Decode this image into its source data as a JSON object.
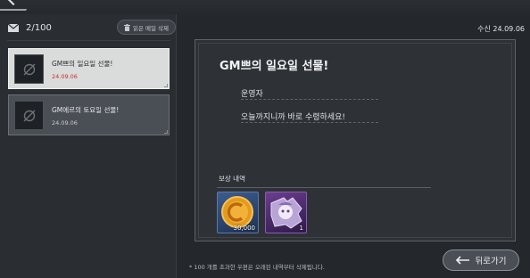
{
  "mailbox": {
    "count": "2/100",
    "delete_read_label": "읽은 메일 삭제",
    "received_date": "수신 24.09.06"
  },
  "mail_list": [
    {
      "title": "GM쁘의 일요일 선물!",
      "date": "24.09.06",
      "selected": true
    },
    {
      "title": "GM에르의 토요일 선물!",
      "date": "24.09.06",
      "selected": false
    }
  ],
  "content": {
    "title": "GM쁘의 일요일 선물!",
    "sender": "운영자",
    "message": "오늘까지니까 바로 수령하세요!",
    "rewards_label": "보상 내역",
    "rewards": [
      {
        "icon": "gold-coin-icon",
        "quantity": "30,000"
      },
      {
        "icon": "puzzle-character-icon",
        "quantity": "1"
      }
    ]
  },
  "footer": {
    "note": "* 100 개를 초과한 우편은 오래된 내역부터 삭제됩니다.",
    "back_label": "뒤로가기"
  }
}
